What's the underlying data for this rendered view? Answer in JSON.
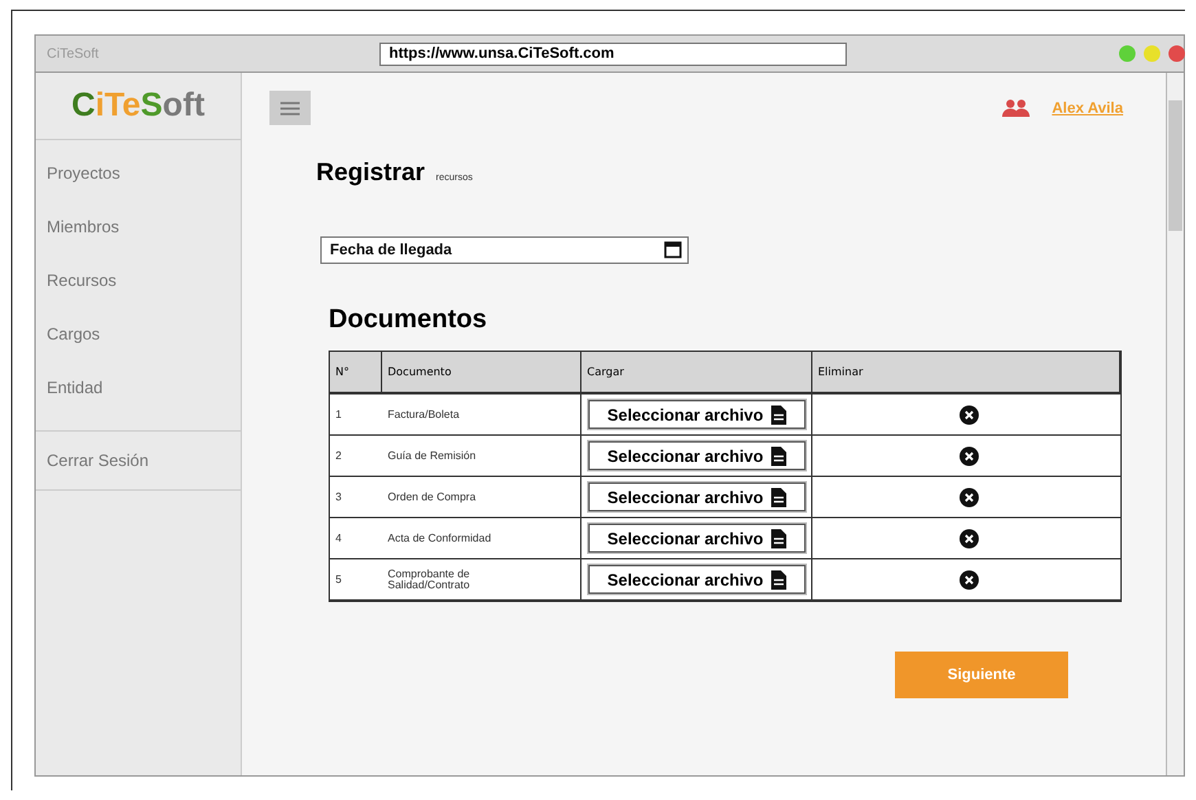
{
  "browser": {
    "tab_title": "CiTeSoft",
    "url": "https://www.unsa.CiTeSoft.com",
    "window_buttons": [
      {
        "color": "#5fd13a"
      },
      {
        "color": "#e8e02a"
      },
      {
        "color": "#e14b4b"
      }
    ]
  },
  "logo": [
    {
      "text": "C",
      "color": "#3f7d1f"
    },
    {
      "text": "i",
      "color": "#f0a030"
    },
    {
      "text": "Te",
      "color": "#f0a030"
    },
    {
      "text": "S",
      "color": "#4f9a2a"
    },
    {
      "text": "oft",
      "color": "#7a7a7a"
    }
  ],
  "sidebar": {
    "items": [
      "Proyectos",
      "Miembros",
      "Recursos",
      "Cargos",
      "Entidad"
    ],
    "logout": "Cerrar Sesión"
  },
  "user": {
    "name": "Alex Avila"
  },
  "heading": {
    "title": "Registrar",
    "subtitle": "recursos"
  },
  "date_field": {
    "placeholder": "Fecha de llegada"
  },
  "section_title": "Documentos",
  "table": {
    "columns": [
      "N°",
      "Documento",
      "Cargar",
      "Eliminar"
    ],
    "rows": [
      {
        "number": "1",
        "document": "Factura/Boleta",
        "upload": "Seleccionar archivo"
      },
      {
        "number": "2",
        "document": "Guía de Remisión",
        "upload": "Seleccionar archivo"
      },
      {
        "number": "3",
        "document": "Orden de Compra",
        "upload": "Seleccionar archivo"
      },
      {
        "number": "4",
        "document": "Acta de Conformidad",
        "upload": "Seleccionar archivo"
      },
      {
        "number": "5",
        "document": "Comprobante de Salidad/Contrato",
        "upload": "Seleccionar archivo"
      }
    ]
  },
  "next_button": "Siguiente"
}
